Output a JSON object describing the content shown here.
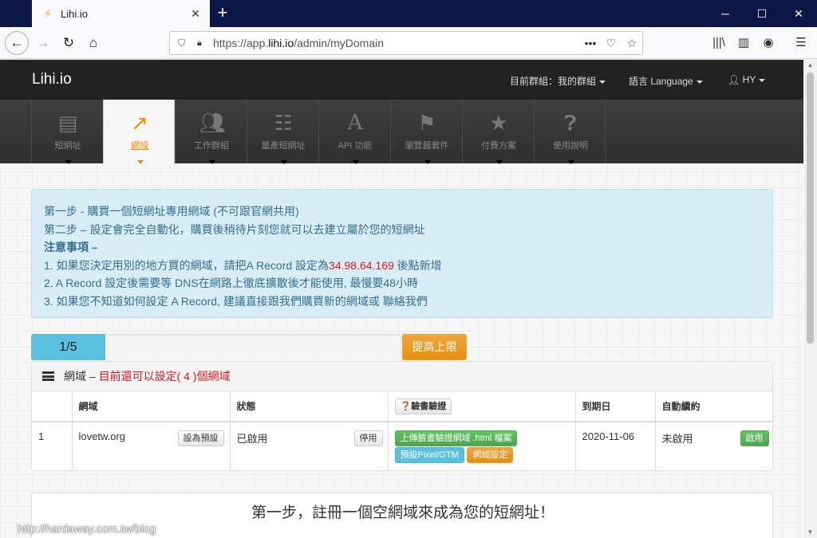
{
  "browser": {
    "tab_title": "Lihi.io",
    "url_prefix": "https://app.",
    "url_domain": "lihi.io",
    "url_path": "/admin/myDomain"
  },
  "site": {
    "brand": "Lihi.io",
    "top_menu": {
      "group": "目前群組：我的群組",
      "language": "語言 Language",
      "user": "HY"
    },
    "nav": [
      {
        "label": "短網址",
        "icon": "list-icon"
      },
      {
        "label": "網域",
        "icon": "external-link-icon"
      },
      {
        "label": "工作群組",
        "icon": "users-icon"
      },
      {
        "label": "量產短網址",
        "icon": "th-list-icon"
      },
      {
        "label": "API 功能",
        "icon": "font-a-icon"
      },
      {
        "label": "瀏覽器套件",
        "icon": "bookmark-icon"
      },
      {
        "label": "付費方案",
        "icon": "star-icon"
      },
      {
        "label": "使用說明",
        "icon": "question-circle-icon"
      }
    ],
    "nav_active_index": 1
  },
  "notice": {
    "line1": "第一步 - 購買一個短網址專用網域 (不可跟官網共用)",
    "line2": "第二步 – 設定會完全自動化，購買後稍待片刻您就可以去建立屬於您的短網址",
    "heading": "注意事項 –",
    "line3_a": "1. 如果您決定用別的地方買的網域，請把A Record 設定為",
    "line3_ip": "34.98.64.169",
    "line3_b": " 後點新增",
    "line4": "2. A Record 設定後需要等 DNS在網路上徹底擴散後才能使用, 最慢要48小時",
    "line5": "3. 如果您不知道如何設定 A Record, 建議直接跟我們購買新的網域或 聯絡我們"
  },
  "quota": {
    "label": "1/5",
    "fraction": 0.2,
    "raise_button": "提高上限"
  },
  "domains_panel": {
    "title": "網域 –",
    "remaining": "目前還可以設定( 4 )個網域",
    "columns": {
      "domain": "網域",
      "status": "狀態",
      "verify": "❓驗書驗證",
      "expiry": "到期日",
      "auto_renew": "自動續約"
    },
    "rows": [
      {
        "index": "1",
        "domain": "lovetw.org",
        "set_default": "設為預設",
        "status": "已啟用",
        "disable": "停用",
        "upload_verify": "上傳臉書驗證網域 .html 檔案",
        "preset_pixel": "預設Pixel/GTM",
        "domain_settings": "網域設定",
        "expiry": "2020-11-06",
        "auto_renew": "未啟用",
        "enable": "啟用"
      }
    ]
  },
  "step_panel": {
    "title": "第一步，註冊一個空網域來成為您的短網址！"
  },
  "watermark": "http://hardaway.com.tw/blog"
}
